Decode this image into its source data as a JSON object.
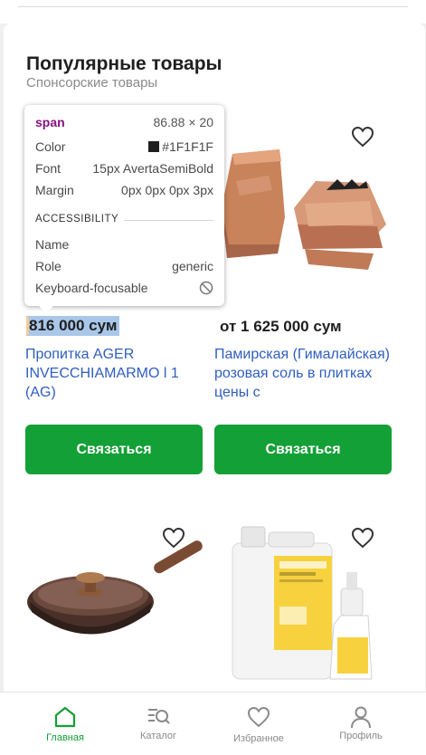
{
  "section": {
    "title": "Популярные товары",
    "subtitle": "Спонсорские товары"
  },
  "products": [
    {
      "price": "816 000  сум",
      "name": "Пропитка AGER INVECCHIAMARMO l 1 (AG)",
      "cta": "Связаться"
    },
    {
      "price": "от  1 625 000  сум",
      "name": "Памирская (Гималайская) розовая соль в плитках цены с",
      "cta": "Связаться"
    },
    {
      "price": "",
      "name": "",
      "cta": ""
    },
    {
      "price": "",
      "name": "",
      "cta": ""
    }
  ],
  "tooltip": {
    "tag": "span",
    "dimensions": "86.88 × 20",
    "color_label": "Color",
    "color_value": "#1F1F1F",
    "font_label": "Font",
    "font_value": "15px AvertaSemiBold",
    "margin_label": "Margin",
    "margin_value": "0px 0px 0px 3px",
    "accessibility_header": "ACCESSIBILITY",
    "name_label": "Name",
    "name_value": "",
    "role_label": "Role",
    "role_value": "generic",
    "keyboard_label": "Keyboard-focusable",
    "keyboard_icon": "blocked-icon"
  },
  "nav": {
    "home": "Главная",
    "catalog": "Каталог",
    "favorites": "Избранное",
    "profile": "Профиль"
  },
  "colors": {
    "accent_green": "#13A036",
    "link_blue": "#2F5EC0",
    "text_dark": "#1F1F1F",
    "text_muted": "#8A8A8A",
    "highlight_content": "#A9C7E9",
    "highlight_margin": "#F6CC92"
  },
  "icons": {
    "heart": "heart-outline-icon",
    "home": "home-icon",
    "catalog": "catalog-search-icon",
    "favorites": "heart-icon",
    "profile": "user-icon"
  }
}
